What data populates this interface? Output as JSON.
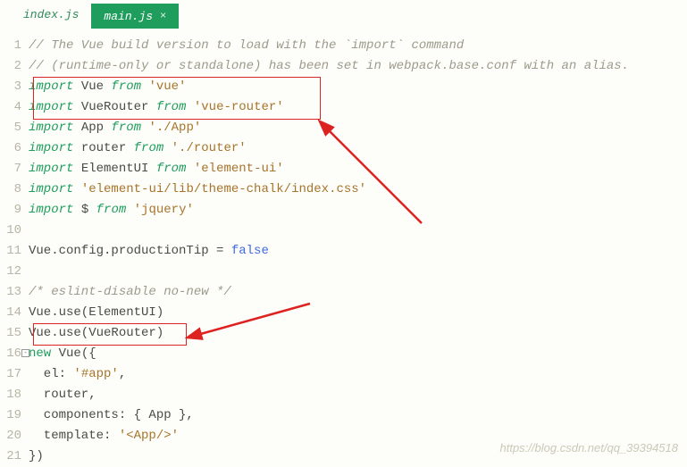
{
  "tabs": {
    "inactive": "index.js",
    "active": "main.js",
    "close": "×"
  },
  "gutter": [
    "1",
    "2",
    "3",
    "4",
    "5",
    "6",
    "7",
    "8",
    "9",
    "10",
    "11",
    "12",
    "13",
    "14",
    "15",
    "16",
    "17",
    "18",
    "19",
    "20",
    "21"
  ],
  "fold": "-",
  "code": {
    "comment1": "// The Vue build version to load with the `import` command",
    "comment2": "// (runtime-only or standalone) has been set in webpack.base.conf with an alias.",
    "l3": {
      "kw": "import",
      "id": " Vue ",
      "from": "from",
      "sp": " ",
      "str": "'vue'"
    },
    "l4": {
      "kw": "import",
      "id": " VueRouter ",
      "from": "from",
      "sp": " ",
      "str": "'vue-router'"
    },
    "l5": {
      "kw": "import",
      "id": " App ",
      "from": "from",
      "sp": " ",
      "str": "'./App'"
    },
    "l6": {
      "kw": "import",
      "id": " router ",
      "from": "from",
      "sp": " ",
      "str": "'./router'"
    },
    "l7": {
      "kw": "import",
      "id": " ElementUI ",
      "from": "from",
      "sp": " ",
      "str": "'element-ui'"
    },
    "l8": {
      "kw": "import",
      "sp": " ",
      "str": "'element-ui/lib/theme-chalk/index.css'"
    },
    "l9": {
      "kw": "import",
      "id": " $ ",
      "from": "from",
      "sp": " ",
      "str": "'jquery'"
    },
    "l11a": "Vue.config.productionTip = ",
    "l11b": "false",
    "l13": "/* eslint-disable no-new */",
    "l14": "Vue.use(ElementUI)",
    "l15": "Vue.use(VueRouter)",
    "l16a": "new",
    "l16b": " Vue({",
    "l17a": "  el: ",
    "l17b": "'#app'",
    "l17c": ",",
    "l18": "  router,",
    "l19": "  components: { App },",
    "l20a": "  template: ",
    "l20b": "'<App/>'",
    "l21": "})"
  },
  "watermark": "https://blog.csdn.net/qq_39394518"
}
